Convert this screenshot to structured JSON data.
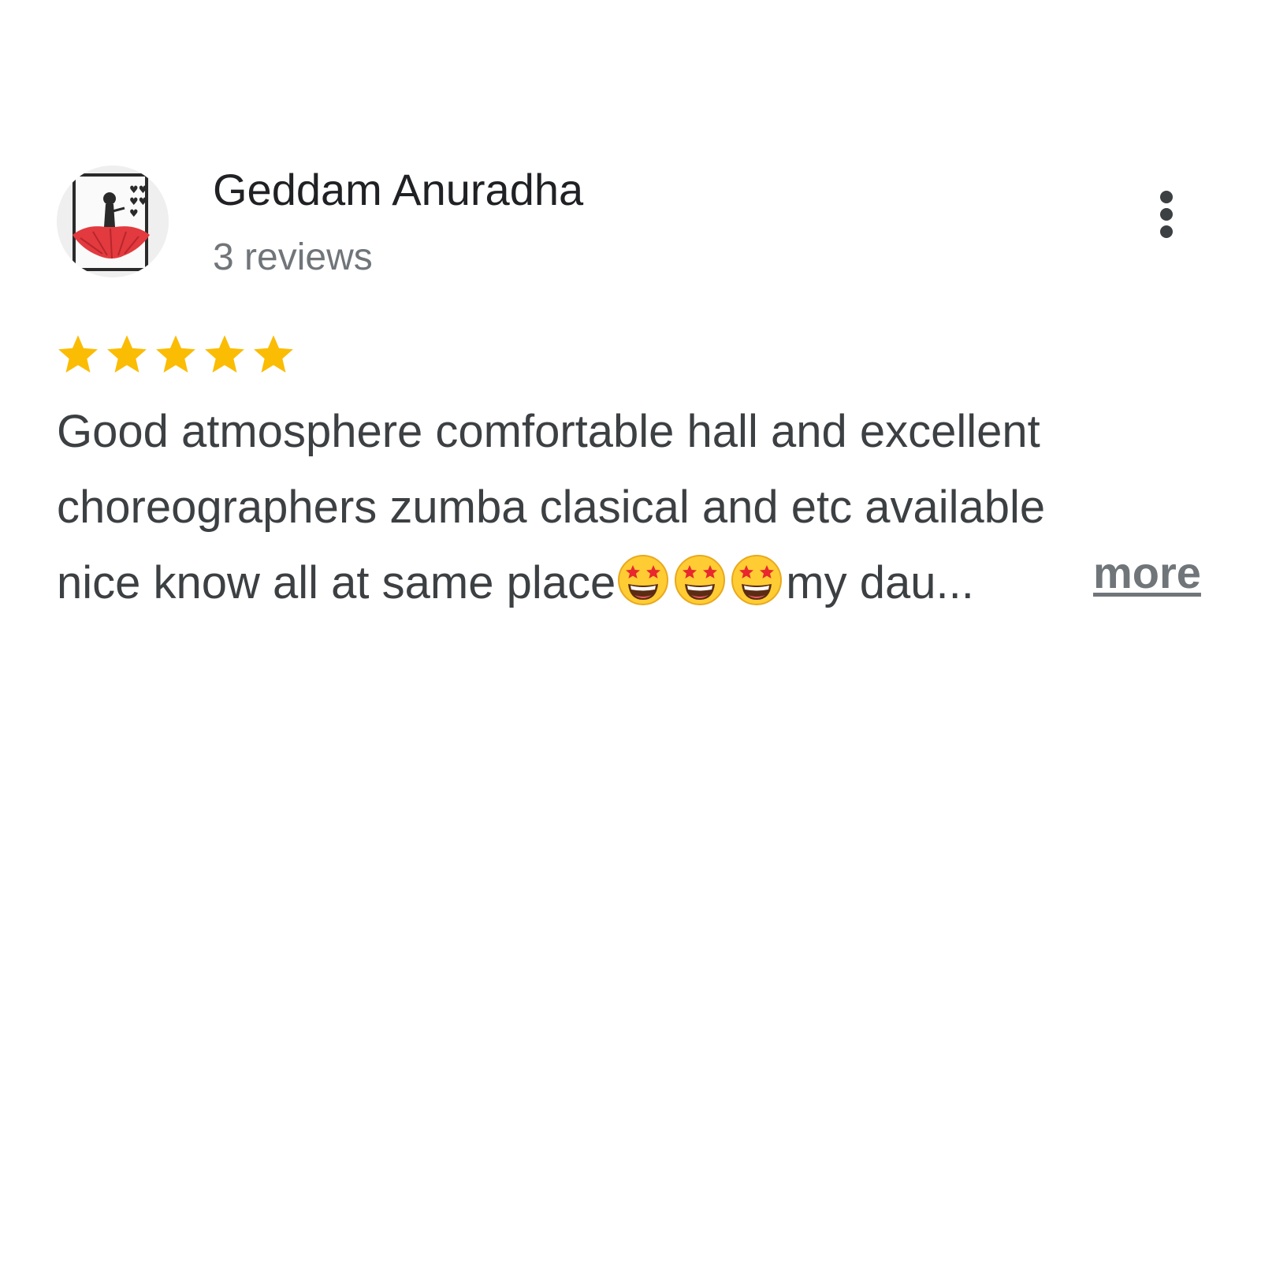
{
  "review": {
    "reviewer_name": "Geddam Anuradha",
    "review_count": "3 reviews",
    "rating": 5,
    "rating_max": 5,
    "text_line_1": "Good atmosphere comfortable hall and excellent",
    "text_line_2": "choreographers zumba clasical and etc available",
    "text_line_3_start": "nice know all at same place",
    "text_line_3_end": "my dau...",
    "more_label": "more"
  },
  "icons": {
    "avatar": "avatar-image",
    "menu": "more-vert-icon",
    "star": "star-icon",
    "emoji": "star-struck-emoji"
  },
  "colors": {
    "star": "#fbbc04",
    "name": "#202124",
    "text": "#3c4043",
    "secondary": "#70757a"
  }
}
